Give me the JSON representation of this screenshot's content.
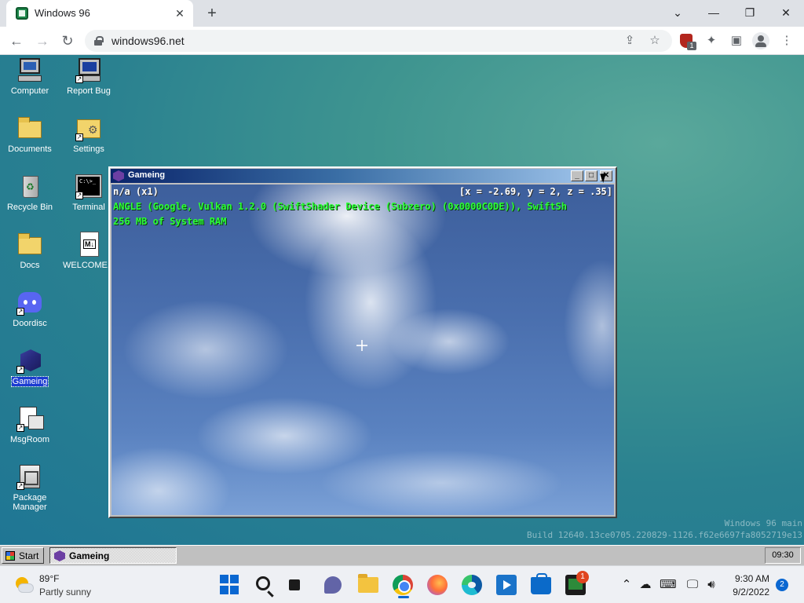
{
  "browser": {
    "tab_title": "Windows 96",
    "tab_close": "✕",
    "new_tab": "+",
    "window_controls": {
      "collapse": "⌄",
      "minimize": "—",
      "restore": "❐",
      "close": "✕"
    },
    "nav": {
      "back": "←",
      "forward": "→",
      "reload": "↻"
    },
    "url": "windows96.net",
    "extension_badge": "1"
  },
  "desktop": {
    "icons": [
      {
        "label": "Computer"
      },
      {
        "label": "Report Bug"
      },
      {
        "label": "Documents"
      },
      {
        "label": "Settings"
      },
      {
        "label": "Recycle Bin"
      },
      {
        "label": "Terminal"
      },
      {
        "label": "Docs"
      },
      {
        "label": "WELCOME..."
      },
      {
        "label": "Doordisc"
      },
      {
        "label": "Gameing"
      },
      {
        "label": "MsgRoom"
      },
      {
        "label": "Package Manager"
      }
    ],
    "watermark_line1": "Windows 96 main",
    "watermark_line2": "Build 12640.13ce0705.220829-1126.f62e6697fa8052719e13"
  },
  "game_window": {
    "title": "Gameing",
    "buttons": {
      "minimize": "_",
      "maximize": "□",
      "close": "✕"
    },
    "hud_fps": "n/a (x1)",
    "hud_coords": "[x = -2.69, y = 2, z = .35]",
    "hud_renderer": "ANGLE (Google, Vulkan 1.2.0 (SwiftShader Device (Subzero) (0x0000C0DE)), SwiftSh",
    "hud_ram": "256 MB of System RAM"
  },
  "w96_taskbar": {
    "start_label": "Start",
    "task_label": "Gameing",
    "clock": "09:30"
  },
  "win11_taskbar": {
    "weather_temp": "89°F",
    "weather_desc": "Partly sunny",
    "store_badge": "1",
    "time": "9:30 AM",
    "date": "9/2/2022",
    "notification_count": "2",
    "tray": {
      "chevron": "⌃"
    }
  },
  "colors": {
    "hud_green": "#2cff37",
    "win96_gray": "#c0c0c0",
    "titlebar_blue": "#0a246a",
    "win11_accent": "#0a67d1"
  }
}
